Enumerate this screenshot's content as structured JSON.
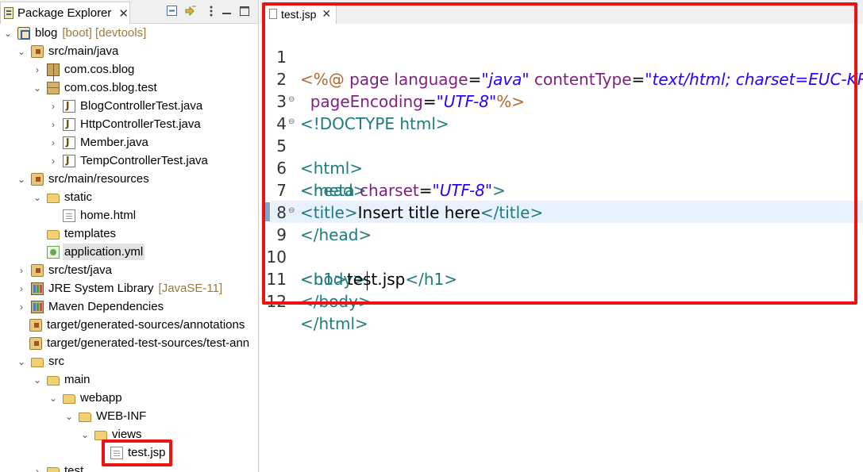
{
  "package_explorer": {
    "title": "Package Explorer",
    "close_glyph": "✕",
    "toolbar_icons": [
      "collapse-all-icon",
      "link-with-editor-icon",
      "view-menu-icon",
      "minimize-icon",
      "maximize-icon"
    ],
    "tree": [
      {
        "label": "blog",
        "deco": "[boot] [devtools]"
      },
      {
        "label": "src/main/java"
      },
      {
        "label": "com.cos.blog"
      },
      {
        "label": "com.cos.blog.test"
      },
      {
        "label": "BlogControllerTest.java"
      },
      {
        "label": "HttpControllerTest.java"
      },
      {
        "label": "Member.java"
      },
      {
        "label": "TempControllerTest.java"
      },
      {
        "label": "src/main/resources"
      },
      {
        "label": "static"
      },
      {
        "label": "home.html"
      },
      {
        "label": "templates"
      },
      {
        "label": "application.yml"
      },
      {
        "label": "src/test/java"
      },
      {
        "label": "JRE System Library",
        "deco": "[JavaSE-11]"
      },
      {
        "label": "Maven Dependencies"
      },
      {
        "label": "target/generated-sources/annotations"
      },
      {
        "label": "target/generated-test-sources/test-ann"
      },
      {
        "label": "src"
      },
      {
        "label": "main"
      },
      {
        "label": "webapp"
      },
      {
        "label": "WEB-INF"
      },
      {
        "label": "views"
      },
      {
        "label": "test.jsp"
      },
      {
        "label": "test"
      }
    ]
  },
  "editor": {
    "tab_label": "test.jsp",
    "close_glyph": "✕",
    "line_numbers": [
      "1",
      "2",
      "3",
      "4",
      "5",
      "6",
      "7",
      "8",
      "9",
      "10",
      "11",
      "12"
    ],
    "lines": [
      {
        "t1": "<%@",
        "t2": "page language",
        "t3": "=",
        "t4": "\"java\"",
        "t5": "contentType",
        "t6": "=",
        "t7": "\"text/html; charset=EUC-KR\""
      },
      {
        "t1": "pageEncoding",
        "t2": "=",
        "t3": "\"UTF-8\"",
        "t4": "%>"
      },
      {
        "t1": "<!DOCTYPE html>"
      },
      {
        "t1": "<html>"
      },
      {
        "t1": "<head>"
      },
      {
        "t1": "<meta",
        "t2": "charset",
        "t3": "=",
        "t4": "\"UTF-8\"",
        "t5": ">"
      },
      {
        "t1": "<title>",
        "t2": "Insert title here",
        "t3": "</title>"
      },
      {
        "t1": "</head>"
      },
      {
        "t1": "<body>"
      },
      {
        "t1": "<h1>",
        "t2": "test.jsp",
        "t3": "</h1>"
      },
      {
        "t1": "</body>"
      },
      {
        "t1": "</html>"
      }
    ]
  },
  "colors": {
    "highlight": "#ee1111",
    "tag": "#1e7b7f",
    "attribute": "#7f1f7f",
    "string": "#2a00ff",
    "directive": "#b5662c",
    "current_line": "#e8f2fe"
  }
}
